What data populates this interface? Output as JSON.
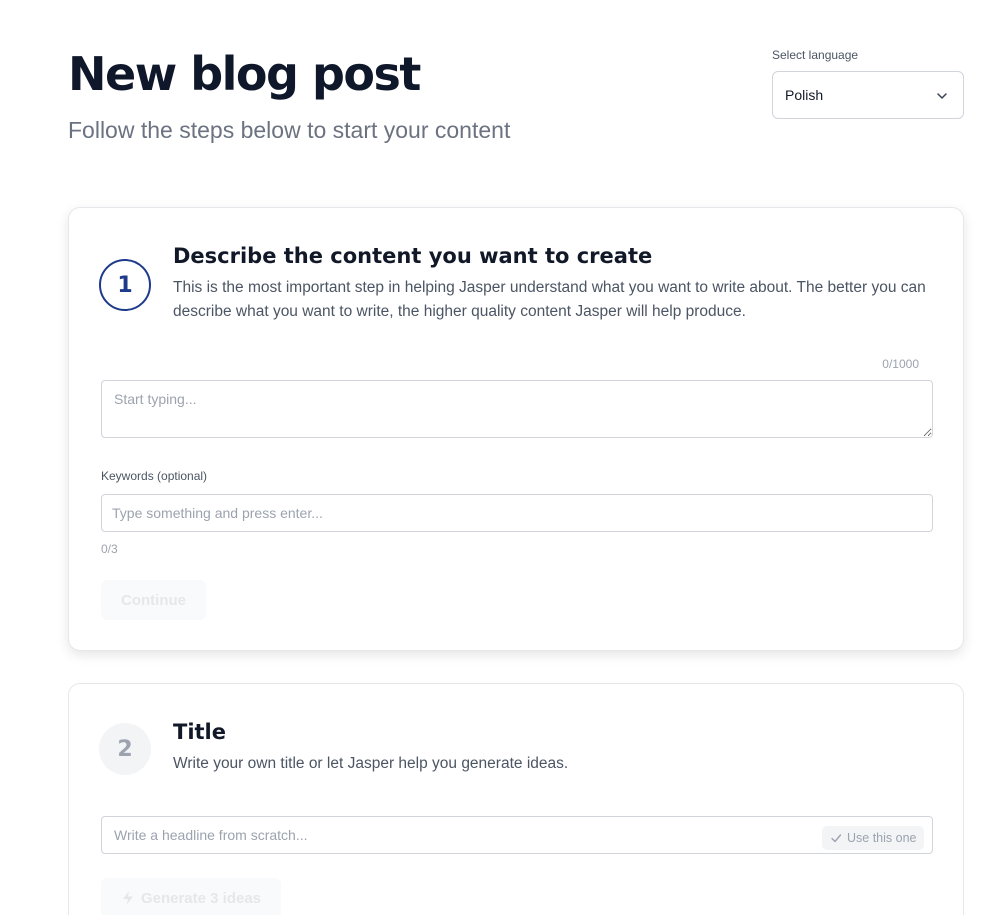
{
  "header": {
    "title": "New blog post",
    "subtitle": "Follow the steps below to start your content"
  },
  "language": {
    "label": "Select language",
    "selected": "Polish",
    "icon": "chevron-down-icon"
  },
  "step1": {
    "number": "1",
    "title": "Describe the content you want to create",
    "description": "This is the most important step in helping Jasper understand what you want to write about. The better you can describe what you want to write, the higher quality content Jasper will help produce.",
    "char_counter": "0/1000",
    "textarea_placeholder": "Start typing...",
    "keywords_label": "Keywords (optional)",
    "keywords_placeholder": "Type something and press enter...",
    "keywords_counter": "0/3",
    "continue_label": "Continue"
  },
  "step2": {
    "number": "2",
    "title": "Title",
    "description": "Write your own title or let Jasper help you generate ideas.",
    "headline_placeholder": "Write a headline from scratch...",
    "use_label": "Use this one",
    "generate_label": "Generate 3 ideas",
    "icons": [
      "check-icon",
      "lightning-icon"
    ]
  },
  "colors": {
    "active_step": "#1e3a8a",
    "muted_text": "#6b7280",
    "disabled_button_bg": "#f9fafb"
  }
}
